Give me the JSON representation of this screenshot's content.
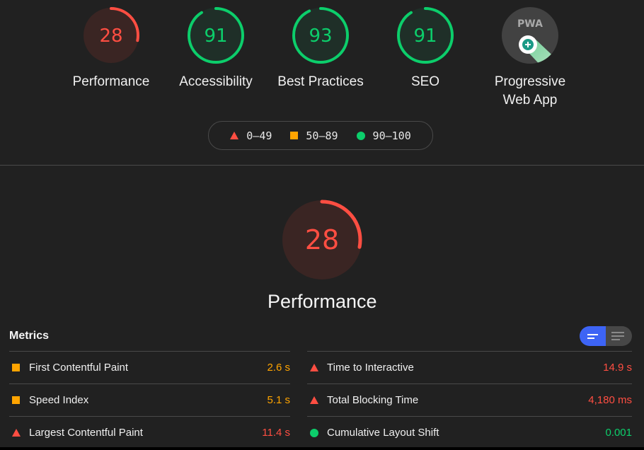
{
  "colors": {
    "fail": "#ff4e42",
    "average": "#ffa400",
    "pass": "#0cce6b",
    "fail_bg": "#3a2523",
    "pass_bg": "#1f2f28",
    "toggle_active": "#3d64f5"
  },
  "gauges": [
    {
      "id": "performance",
      "score": 28,
      "label": "Performance",
      "rating": "fail"
    },
    {
      "id": "accessibility",
      "score": 91,
      "label": "Accessibility",
      "rating": "pass"
    },
    {
      "id": "best-practices",
      "score": 93,
      "label": "Best Practices",
      "rating": "pass"
    },
    {
      "id": "seo",
      "score": 91,
      "label": "SEO",
      "rating": "pass"
    }
  ],
  "pwa": {
    "label_line1": "Progressive",
    "label_line2": "Web App",
    "badge_text": "PWA",
    "icon": "pwa-badge-icon"
  },
  "legend": [
    {
      "icon": "triangle-icon",
      "range": "0–49"
    },
    {
      "icon": "square-icon",
      "range": "50–89"
    },
    {
      "icon": "circle-icon",
      "range": "90–100"
    }
  ],
  "performance_section": {
    "score": 28,
    "label": "Performance"
  },
  "metrics": {
    "title": "Metrics",
    "toggle": {
      "compact_icon": "compact-view-icon",
      "expanded_icon": "expanded-view-icon",
      "active": "compact"
    },
    "left": [
      {
        "name": "First Contentful Paint",
        "value": "2.6 s",
        "rating": "average"
      },
      {
        "name": "Speed Index",
        "value": "5.1 s",
        "rating": "average"
      },
      {
        "name": "Largest Contentful Paint",
        "value": "11.4 s",
        "rating": "fail"
      }
    ],
    "right": [
      {
        "name": "Time to Interactive",
        "value": "14.9 s",
        "rating": "fail"
      },
      {
        "name": "Total Blocking Time",
        "value": "4,180 ms",
        "rating": "fail"
      },
      {
        "name": "Cumulative Layout Shift",
        "value": "0.001",
        "rating": "pass"
      }
    ]
  }
}
